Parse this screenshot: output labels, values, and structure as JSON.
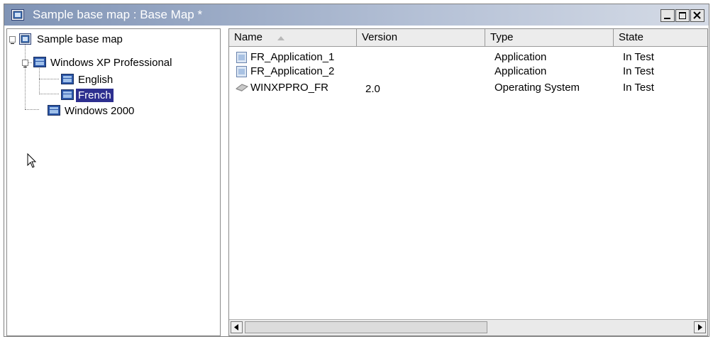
{
  "window": {
    "title": "Sample base map : Base Map *",
    "controls": [
      "minimize-icon",
      "restore-icon",
      "close-icon"
    ]
  },
  "tree": {
    "root": "Sample base map",
    "items": [
      {
        "label": "Windows XP Professional",
        "children": [
          "English",
          "French"
        ]
      },
      {
        "label": "Windows 2000"
      }
    ],
    "selected": "French"
  },
  "list": {
    "columns": [
      "Name",
      "Version",
      "Type",
      "State"
    ],
    "sort_column": "Name",
    "rows": [
      {
        "name": "FR_Application_1",
        "version": "",
        "type": "Application",
        "state": "In Test",
        "icon": "application-icon"
      },
      {
        "name": "FR_Application_2",
        "version": "",
        "type": "Application",
        "state": "In Test",
        "icon": "application-icon"
      },
      {
        "name": "WINXPPRO_FR",
        "version": "2.0",
        "type": "Operating System",
        "state": "In Test",
        "icon": "operating-system-icon"
      }
    ]
  },
  "colors": {
    "titlebar_start": "#7f93b5",
    "selection": "#2d2f8f"
  }
}
